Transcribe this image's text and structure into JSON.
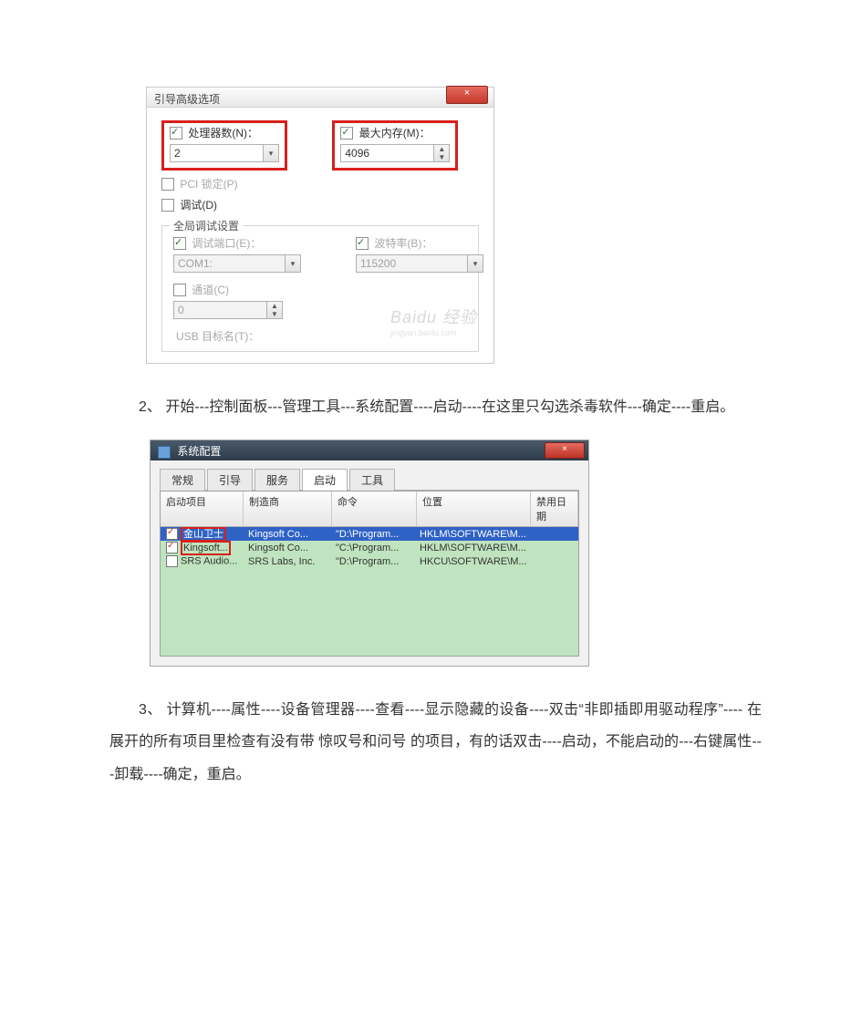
{
  "dlg1": {
    "title": "引导高级选项",
    "close_x": "×",
    "cpu": {
      "label": "处理器数(N)：",
      "value": "2"
    },
    "mem": {
      "label": "最大内存(M)：",
      "value": "4096"
    },
    "pci_lock": "PCI 锁定(P)",
    "debug_ck": "调试(D)",
    "group_title": "全局调试设置",
    "debug_port_label": "调试端口(E)：",
    "debug_port_value": "COM1:",
    "baud_label": "波特率(B)：",
    "baud_value": "115200",
    "channel_label": "通道(C)",
    "channel_value": "0",
    "usb_label": "USB 目标名(T)：",
    "watermark_main": "Baidu 经验",
    "watermark_sub": "jingyan.baidu.com"
  },
  "para2": "2、 开始---控制面板---管理工具---系统配置----启动----在这里只勾选杀毒软件---确定----重启。",
  "dlg2": {
    "title": "系统配置",
    "tabs": [
      "常规",
      "引导",
      "服务",
      "启动",
      "工具"
    ],
    "active_tab_index": 3,
    "cols": [
      "启动项目",
      "制造商",
      "命令",
      "位置",
      "禁用日期"
    ],
    "rows": [
      {
        "checked": true,
        "selected": true,
        "boxed": true,
        "c1": "金山卫士",
        "c2": "Kingsoft Co...",
        "c3": "\"D:\\Program...",
        "c4": "HKLM\\SOFTWARE\\M...",
        "c5": ""
      },
      {
        "checked": true,
        "selected": false,
        "boxed": true,
        "c1": "Kingsoft...",
        "c2": "Kingsoft Co...",
        "c3": "\"C:\\Program...",
        "c4": "HKLM\\SOFTWARE\\M...",
        "c5": ""
      },
      {
        "checked": false,
        "selected": false,
        "boxed": false,
        "c1": "SRS Audio...",
        "c2": "SRS Labs, Inc.",
        "c3": "\"D:\\Program...",
        "c4": "HKCU\\SOFTWARE\\M...",
        "c5": ""
      }
    ]
  },
  "para3": "3、 计算机----属性----设备管理器----查看----显示隐藏的设备----双击“非即插即用驱动程序”---- 在展开的所有项目里检查有没有带 惊叹号和问号 的项目，有的话双击----启动，不能启动的---右键属性---卸载----确定，重启。"
}
